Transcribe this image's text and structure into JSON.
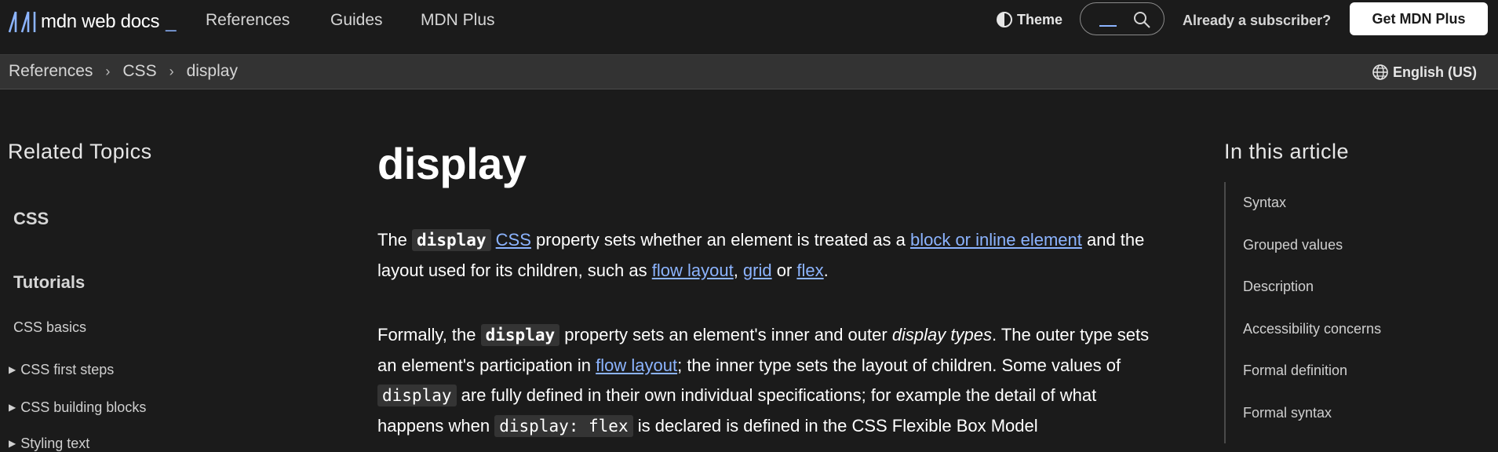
{
  "header": {
    "logo_text": "mdn web docs",
    "logo_underscore": "_",
    "nav": [
      "References",
      "Guides",
      "MDN Plus"
    ],
    "theme_label": "Theme",
    "subscriber_label": "Already a subscriber?",
    "cta_label": "Get MDN Plus"
  },
  "breadcrumb": {
    "items": [
      "References",
      "CSS",
      "display"
    ],
    "separator": "›"
  },
  "language": "English (US)",
  "sidebar": {
    "title": "Related Topics",
    "heading_css": "CSS",
    "heading_tutorials": "Tutorials",
    "items": [
      "CSS basics",
      "CSS first steps",
      "CSS building blocks",
      "Styling text"
    ]
  },
  "article": {
    "title": "display",
    "p1": {
      "t1": "The ",
      "code1": "display",
      "link_css": "CSS",
      "t2": " property sets whether an element is treated as a ",
      "link_block": "block or inline element",
      "t3": " and the layout used for its children, such as ",
      "link_flow": "flow layout",
      "t4": ", ",
      "link_grid": "grid",
      "t5": " or ",
      "link_flex": "flex",
      "t6": "."
    },
    "p2": {
      "t1": "Formally, the ",
      "code1": "display",
      "t2": " property sets an element's inner and outer ",
      "em1": "display types",
      "t3": ". The outer type sets an element's participation in ",
      "link_flow": "flow layout",
      "t4": "; the inner type sets the layout of children. Some values of ",
      "code2": "display",
      "t5": " are fully defined in their own individual specifications; for example the detail of what happens when ",
      "code3": "display: flex",
      "t6": " is declared is defined in the CSS Flexible Box Model"
    }
  },
  "toc": {
    "title": "In this article",
    "items": [
      "Syntax",
      "Grouped values",
      "Description",
      "Accessibility concerns",
      "Formal definition",
      "Formal syntax"
    ]
  },
  "colors": {
    "background": "#1b1b1b",
    "breadcrumb_bar": "#333333",
    "link": "#8cb4ff",
    "code_bg": "#343434"
  }
}
